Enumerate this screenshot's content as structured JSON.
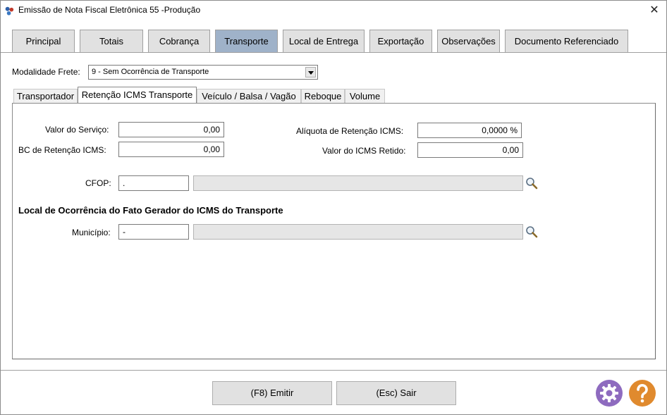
{
  "window": {
    "title": "Emissão de Nota Fiscal Eletrônica 55 -Produção",
    "close_glyph": "✕"
  },
  "main_tabs": [
    {
      "label": "Principal"
    },
    {
      "label": "Totais"
    },
    {
      "label": "Cobrança"
    },
    {
      "label": "Transporte",
      "active": true
    },
    {
      "label": "Local de Entrega"
    },
    {
      "label": "Exportação"
    },
    {
      "label": "Observações"
    },
    {
      "label": "Documento Referenciado"
    }
  ],
  "modalidade": {
    "label": "Modalidade Frete:",
    "value": "9 - Sem Ocorrência de Transporte"
  },
  "sub_tabs": [
    {
      "label": "Transportador"
    },
    {
      "label": "Retenção ICMS Transporte",
      "active": true
    },
    {
      "label": "Veículo / Balsa / Vagão"
    },
    {
      "label": "Reboque"
    },
    {
      "label": "Volume"
    }
  ],
  "form": {
    "valor_servico": {
      "label": "Valor do Serviço:",
      "value": "0,00"
    },
    "bc_retencao": {
      "label": "BC de Retenção ICMS:",
      "value": "0,00"
    },
    "aliquota": {
      "label": "Alíquota de Retenção ICMS:",
      "value": "0,0000 %"
    },
    "valor_icms_retido": {
      "label": "Valor do ICMS Retido:",
      "value": "0,00"
    },
    "cfop": {
      "label": "CFOP:",
      "code": ".",
      "description": ""
    },
    "section_title": "Local de Ocorrência do Fato Gerador do ICMS do Transporte",
    "municipio": {
      "label": "Município:",
      "code": "-",
      "description": ""
    }
  },
  "footer": {
    "emit_label": "(F8) Emitir",
    "exit_label": "(Esc) Sair"
  },
  "colors": {
    "active_tab": "#9fb2c9",
    "settings_icon": "#8e6bbf",
    "help_icon": "#e08a2e"
  },
  "icons": {
    "app": "app-logo-icon",
    "search": "magnifier-icon",
    "settings": "gear-icon",
    "help": "question-icon"
  }
}
